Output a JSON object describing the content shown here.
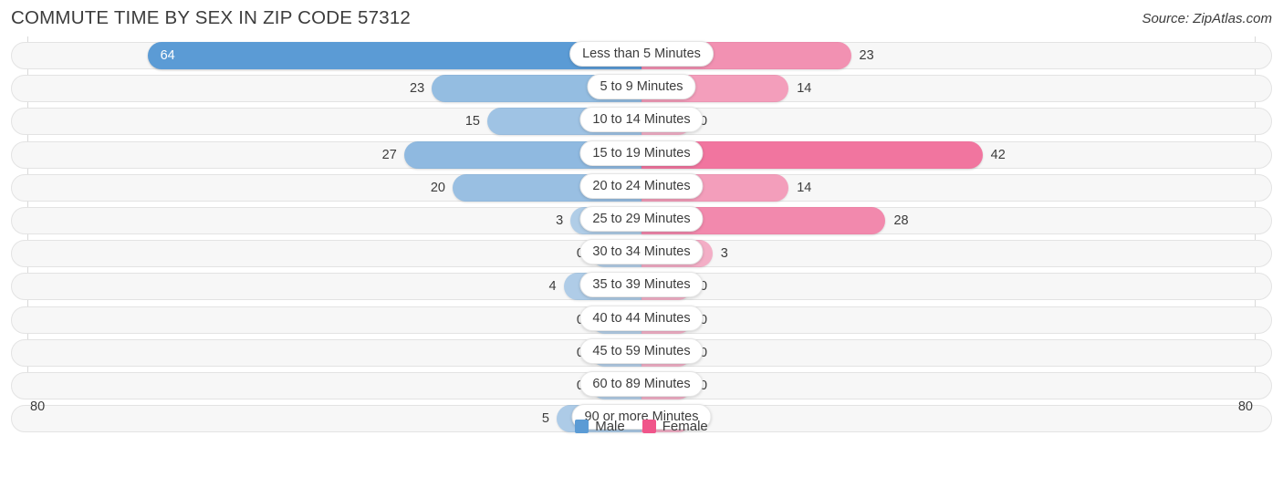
{
  "header": {
    "title": "COMMUTE TIME BY SEX IN ZIP CODE 57312",
    "source": "Source: ZipAtlas.com"
  },
  "axis": {
    "left_max": "80",
    "right_max": "80"
  },
  "legend": {
    "items": [
      {
        "label": "Male",
        "color": "#5b9bd5",
        "icon": "male-swatch"
      },
      {
        "label": "Female",
        "color": "#f0558a",
        "icon": "female-swatch"
      }
    ]
  },
  "chart_data": {
    "type": "bar",
    "subtype": "diverging-butterfly",
    "title": "Commute Time by Sex in Zip Code 57312",
    "xlabel": "",
    "ylabel": "",
    "xlim": [
      80,
      80
    ],
    "grid": true,
    "legend_position": "bottom-center",
    "categories": [
      "Less than 5 Minutes",
      "5 to 9 Minutes",
      "10 to 14 Minutes",
      "15 to 19 Minutes",
      "20 to 24 Minutes",
      "25 to 29 Minutes",
      "30 to 34 Minutes",
      "35 to 39 Minutes",
      "40 to 44 Minutes",
      "45 to 59 Minutes",
      "60 to 89 Minutes",
      "90 or more Minutes"
    ],
    "series": [
      {
        "name": "Male",
        "color": "#5b9bd5",
        "direction": "left",
        "values": [
          64,
          23,
          15,
          27,
          20,
          3,
          0,
          4,
          0,
          0,
          0,
          5
        ]
      },
      {
        "name": "Female",
        "color": "#f0558a",
        "direction": "right",
        "values": [
          23,
          14,
          0,
          42,
          14,
          28,
          3,
          0,
          0,
          0,
          0,
          0
        ]
      }
    ]
  }
}
